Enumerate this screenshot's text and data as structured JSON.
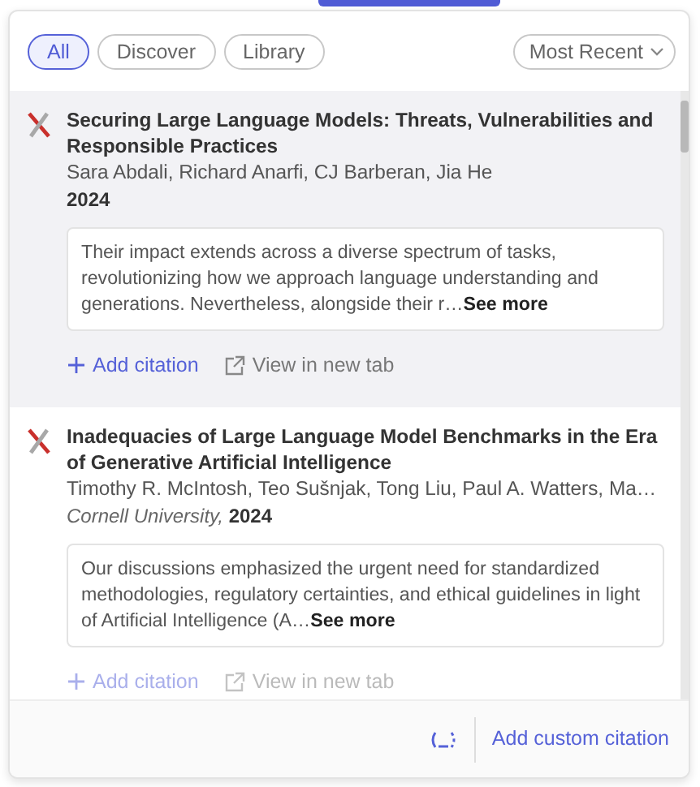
{
  "filters": [
    {
      "label": "All",
      "selected": true
    },
    {
      "label": "Discover",
      "selected": false
    },
    {
      "label": "Library",
      "selected": false
    }
  ],
  "sort": {
    "label": "Most Recent"
  },
  "results": [
    {
      "title": "Securing Large Language Models: Threats, Vulnerabilities and Responsible Practices",
      "authors": "Sara Abdali, Richard Anarfi, CJ Barberan, Jia He",
      "year": "2024",
      "abstract": "Their impact extends across a diverse spectrum of tasks, revolutionizing how we approach language understanding and generations. Nevertheless, alongside their r…",
      "see_more": "See more",
      "highlighted": true,
      "dimmed": false,
      "actions": [
        "Add citation",
        "View in new tab"
      ]
    },
    {
      "title": "Inadequacies of Large Language Model Benchmarks in the Era of Generative Artificial Intelligence",
      "authors": "Timothy R. McIntosh, Teo Sušnjak, Tong Liu, Paul A. Watters, Ma…",
      "venue": "Cornell University,",
      "year": "2024",
      "abstract": "Our discussions emphasized the urgent need for standardized methodologies, regulatory certainties, and ethical guidelines in light of Artificial Intelligence (A…",
      "see_more": "See more",
      "highlighted": false,
      "dimmed": true,
      "actions": [
        "Add citation",
        "View in new tab"
      ]
    }
  ],
  "footer": {
    "link": "Add custom citation"
  }
}
